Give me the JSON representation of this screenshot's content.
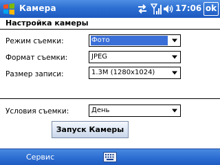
{
  "titlebar": {
    "app_title": "Камера",
    "time": "17:06",
    "ok_label": "ok",
    "icons": [
      "windows-start-icon",
      "sync-arrows-icon",
      "signal-strength-icon",
      "volume-icon"
    ]
  },
  "page": {
    "heading": "Настройка камеры"
  },
  "form": {
    "mode": {
      "label": "Режим съемки:",
      "value": "Фото"
    },
    "format": {
      "label": "Формат съемки:",
      "value": "JPEG"
    },
    "size": {
      "label": "Размер записи:",
      "value": "1.3M (1280x1024)"
    },
    "conditions": {
      "label": "Условия съемки:",
      "value": "День"
    }
  },
  "actions": {
    "launch_label": "Запуск Камеры"
  },
  "menubar": {
    "left_label": "Сервис",
    "keyboard_icon": "keyboard-icon"
  },
  "colors": {
    "titlebar": "#2c6fd2",
    "selection": "#3a6fd8",
    "menubar": "#2e70d3"
  }
}
